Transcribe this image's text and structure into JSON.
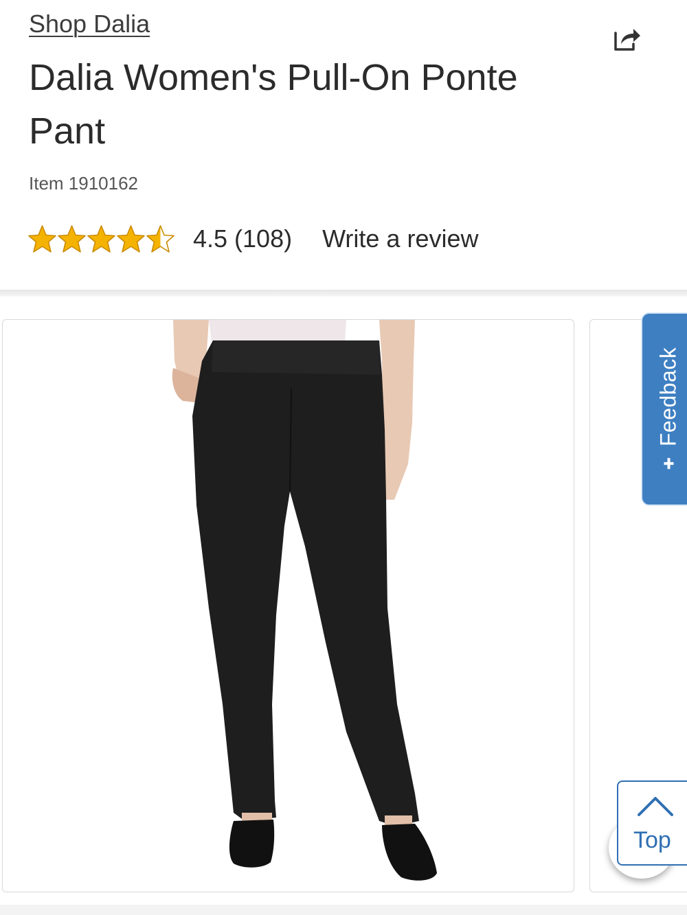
{
  "header": {
    "shop_link": "Shop Dalia",
    "share_icon": "share-icon"
  },
  "product": {
    "title": "Dalia Women's Pull-On Ponte Pant",
    "item_number": "Item 1910162",
    "rating_value": 4.5,
    "rating_text": "4.5 (108)",
    "stars_max": 5,
    "write_review": "Write a review",
    "image_alt_icon": "product-image"
  },
  "feedback": {
    "label": "Feedback"
  },
  "back_to_top": {
    "label": "Top"
  },
  "colors": {
    "star": "#f5b301",
    "feedback_bg": "#3e7fc2",
    "top_accent": "#2f6fb3",
    "text": "#2b2b2b"
  }
}
